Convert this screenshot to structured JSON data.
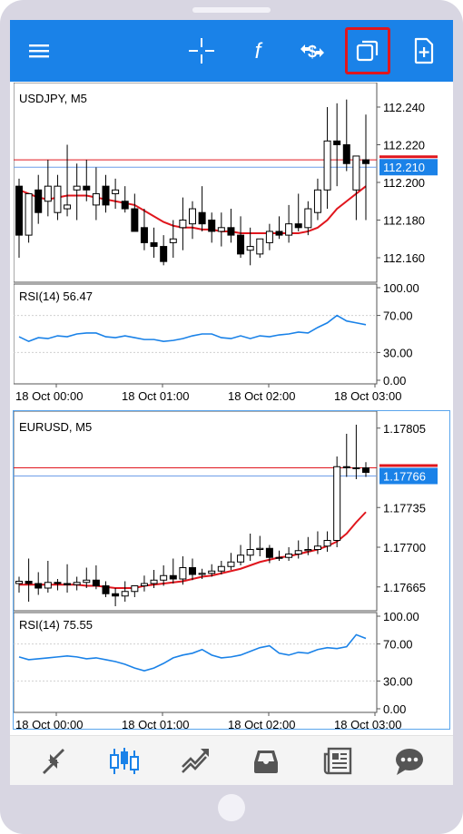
{
  "toolbar": {
    "icons": [
      "menu-icon",
      "crosshair-icon",
      "indicators-icon",
      "symbols-icon",
      "charts-icon",
      "new-order-icon"
    ],
    "active_highlight_color": "#e0161d",
    "background_color": "#1a82e8"
  },
  "colors": {
    "bull_candle": "#ffffff",
    "bear_candle": "#000000",
    "moving_average": "#e0161d",
    "rsi_line": "#1a82e8",
    "bid_line": "#e0161d",
    "ask_line": "#6e9ee8",
    "price_badge": "#1a82e8",
    "active_nav": "#1a82e8"
  },
  "usdjpy": {
    "title": "USDJPY, M5",
    "price_ticks": [
      "112.240",
      "112.220",
      "112.200",
      "112.180",
      "112.160"
    ],
    "current_price": "112.210",
    "rsi_label": "RSI(14) 56.47",
    "rsi_ticks": [
      "100.00",
      "70.00",
      "30.00",
      "0.00"
    ],
    "time_labels": [
      "18 Oct 00:00",
      "18 Oct 01:00",
      "18 Oct 02:00",
      "18 Oct 03:00"
    ]
  },
  "eurusd": {
    "title": "EURUSD, M5",
    "price_ticks": [
      "1.17805",
      "1.17735",
      "1.17700",
      "1.17665"
    ],
    "current_price": "1.17766",
    "rsi_label": "RSI(14) 75.55",
    "rsi_ticks": [
      "100.00",
      "70.00",
      "30.00",
      "0.00"
    ],
    "time_labels": [
      "18 Oct 00:00",
      "18 Oct 01:00",
      "18 Oct 02:00",
      "18 Oct 03:00"
    ]
  },
  "chart_data": [
    {
      "type": "candlestick",
      "title": "USDJPY, M5",
      "ylim": [
        112.147,
        112.253
      ],
      "current_price": 112.21,
      "bid_line": 112.212,
      "ask_line": 112.21,
      "x": [
        "00:00",
        "00:05",
        "00:10",
        "00:15",
        "00:20",
        "00:25",
        "00:30",
        "00:35",
        "00:40",
        "00:45",
        "00:50",
        "00:55",
        "01:00",
        "01:05",
        "01:10",
        "01:15",
        "01:20",
        "01:25",
        "01:30",
        "01:35",
        "01:40",
        "01:45",
        "01:50",
        "01:55",
        "02:00",
        "02:05",
        "02:10",
        "02:15",
        "02:20",
        "02:25",
        "02:30",
        "02:35",
        "02:40",
        "02:45",
        "02:50",
        "02:55",
        "03:00"
      ],
      "open": [
        112.198,
        112.172,
        112.196,
        112.19,
        112.184,
        112.186,
        112.196,
        112.198,
        112.188,
        112.198,
        112.194,
        112.19,
        112.186,
        112.176,
        112.168,
        112.166,
        112.168,
        112.176,
        112.178,
        112.184,
        112.18,
        112.174,
        112.176,
        112.172,
        112.164,
        112.162,
        112.168,
        112.174,
        112.172,
        112.178,
        112.176,
        112.184,
        112.196,
        112.222,
        112.22,
        112.196,
        112.212
      ],
      "high": [
        112.202,
        112.194,
        112.204,
        112.212,
        112.204,
        112.22,
        112.21,
        112.212,
        112.208,
        112.204,
        112.202,
        112.198,
        112.194,
        112.186,
        112.176,
        112.172,
        112.18,
        112.192,
        112.19,
        112.198,
        112.184,
        112.184,
        112.186,
        112.182,
        112.176,
        112.17,
        112.178,
        112.182,
        112.188,
        112.194,
        112.19,
        112.202,
        112.24,
        112.242,
        112.244,
        112.206,
        112.236
      ],
      "low": [
        112.16,
        112.168,
        112.178,
        112.182,
        112.18,
        112.182,
        112.18,
        112.19,
        112.18,
        112.184,
        112.186,
        112.184,
        112.174,
        112.164,
        112.16,
        112.156,
        112.16,
        112.164,
        112.17,
        112.174,
        112.168,
        112.166,
        112.168,
        112.16,
        112.156,
        112.16,
        112.164,
        112.17,
        112.168,
        112.174,
        112.172,
        112.18,
        112.186,
        112.198,
        112.206,
        112.18,
        112.18
      ],
      "close": [
        112.172,
        112.194,
        112.184,
        112.198,
        112.198,
        112.188,
        112.198,
        112.196,
        112.194,
        112.188,
        112.196,
        112.186,
        112.174,
        112.168,
        112.166,
        112.158,
        112.17,
        112.18,
        112.186,
        112.178,
        112.174,
        112.176,
        112.172,
        112.162,
        112.166,
        112.17,
        112.174,
        112.172,
        112.178,
        112.176,
        112.186,
        112.196,
        112.222,
        112.22,
        112.21,
        112.214,
        112.21
      ],
      "ma": [
        112.196,
        112.194,
        112.192,
        112.191,
        112.192,
        112.193,
        112.193,
        112.193,
        112.192,
        112.191,
        112.19,
        112.189,
        112.188,
        112.185,
        112.182,
        112.179,
        112.177,
        112.176,
        112.176,
        112.175,
        112.175,
        112.174,
        112.174,
        112.173,
        112.173,
        112.173,
        112.173,
        112.173,
        112.173,
        112.173,
        112.174,
        112.176,
        112.18,
        112.186,
        112.19,
        112.194,
        112.198
      ],
      "rsi": {
        "label": "RSI(14)",
        "last": 56.47,
        "ylim": [
          0,
          100
        ],
        "values": [
          47,
          42,
          46,
          45,
          48,
          47,
          50,
          51,
          51,
          47,
          46,
          48,
          46,
          44,
          44,
          42,
          43,
          45,
          48,
          50,
          50,
          46,
          45,
          48,
          45,
          48,
          47,
          49,
          50,
          52,
          51,
          57,
          62,
          70,
          64,
          62,
          60
        ]
      }
    },
    {
      "type": "candlestick",
      "title": "EURUSD, M5",
      "ylim": [
        1.17644,
        1.1782
      ],
      "current_price": 1.17766,
      "bid_line": 1.1777,
      "ask_line": 1.17766,
      "x": [
        "00:00",
        "00:05",
        "00:10",
        "00:15",
        "00:20",
        "00:25",
        "00:30",
        "00:35",
        "00:40",
        "00:45",
        "00:50",
        "00:55",
        "01:00",
        "01:05",
        "01:10",
        "01:15",
        "01:20",
        "01:25",
        "01:30",
        "01:35",
        "01:40",
        "01:45",
        "01:50",
        "01:55",
        "02:00",
        "02:05",
        "02:10",
        "02:15",
        "02:20",
        "02:25",
        "02:30",
        "02:35",
        "02:40",
        "02:45",
        "02:50",
        "02:55",
        "03:00"
      ],
      "open": [
        1.17668,
        1.1767,
        1.17668,
        1.17664,
        1.17669,
        1.17668,
        1.17667,
        1.17669,
        1.17671,
        1.17666,
        1.17659,
        1.17657,
        1.17661,
        1.17666,
        1.17668,
        1.17671,
        1.17675,
        1.17672,
        1.17682,
        1.17676,
        1.17677,
        1.17679,
        1.17683,
        1.17687,
        1.17693,
        1.17698,
        1.17699,
        1.17691,
        1.17691,
        1.17694,
        1.17697,
        1.17698,
        1.17701,
        1.17706,
        1.17771,
        1.1777,
        1.1777
      ],
      "high": [
        1.17674,
        1.1769,
        1.17678,
        1.17688,
        1.17672,
        1.17685,
        1.17674,
        1.17682,
        1.17684,
        1.1767,
        1.17664,
        1.1767,
        1.17666,
        1.17675,
        1.1768,
        1.17684,
        1.1769,
        1.17692,
        1.1769,
        1.17681,
        1.17685,
        1.17688,
        1.17695,
        1.17702,
        1.17712,
        1.1771,
        1.17702,
        1.17697,
        1.177,
        1.17706,
        1.17709,
        1.17714,
        1.17714,
        1.1778,
        1.178,
        1.17808,
        1.17775
      ],
      "low": [
        1.1766,
        1.17652,
        1.17658,
        1.1766,
        1.17662,
        1.1766,
        1.17662,
        1.17664,
        1.17663,
        1.17656,
        1.17648,
        1.17652,
        1.17656,
        1.17661,
        1.17664,
        1.17666,
        1.17668,
        1.17667,
        1.17671,
        1.17672,
        1.17674,
        1.17676,
        1.1768,
        1.17684,
        1.17688,
        1.17692,
        1.17686,
        1.17688,
        1.17688,
        1.1769,
        1.17693,
        1.17694,
        1.17696,
        1.177,
        1.17762,
        1.1776,
        1.17762
      ],
      "close": [
        1.1767,
        1.17668,
        1.17664,
        1.17669,
        1.17668,
        1.17667,
        1.17669,
        1.17671,
        1.17666,
        1.17659,
        1.17657,
        1.17661,
        1.17666,
        1.17668,
        1.17671,
        1.17675,
        1.17672,
        1.17682,
        1.17676,
        1.17677,
        1.17679,
        1.17683,
        1.17687,
        1.17693,
        1.17698,
        1.17699,
        1.17691,
        1.17691,
        1.17694,
        1.17697,
        1.17698,
        1.17701,
        1.17706,
        1.17771,
        1.1777,
        1.1777,
        1.17766
      ],
      "ma": [
        1.17667,
        1.17667,
        1.17667,
        1.17667,
        1.17667,
        1.17667,
        1.17667,
        1.17666,
        1.17666,
        1.17665,
        1.17664,
        1.17664,
        1.17664,
        1.17666,
        1.17667,
        1.17668,
        1.17669,
        1.1767,
        1.17672,
        1.17674,
        1.17675,
        1.17677,
        1.17679,
        1.17681,
        1.17684,
        1.17687,
        1.17689,
        1.17691,
        1.17692,
        1.17694,
        1.17696,
        1.17698,
        1.17701,
        1.17705,
        1.17712,
        1.17722,
        1.17731
      ],
      "rsi": {
        "label": "RSI(14)",
        "last": 75.55,
        "ylim": [
          0,
          100
        ],
        "values": [
          56,
          53,
          54,
          55,
          56,
          57,
          56,
          54,
          55,
          53,
          51,
          48,
          44,
          41,
          44,
          49,
          55,
          58,
          60,
          64,
          58,
          55,
          56,
          58,
          62,
          66,
          68,
          60,
          58,
          61,
          60,
          64,
          66,
          65,
          67,
          80,
          76
        ]
      }
    }
  ],
  "bottom_nav": {
    "icons": [
      "quotes-icon",
      "chart-icon",
      "trade-icon",
      "history-icon",
      "news-icon",
      "messages-icon"
    ],
    "active": "chart-icon"
  }
}
